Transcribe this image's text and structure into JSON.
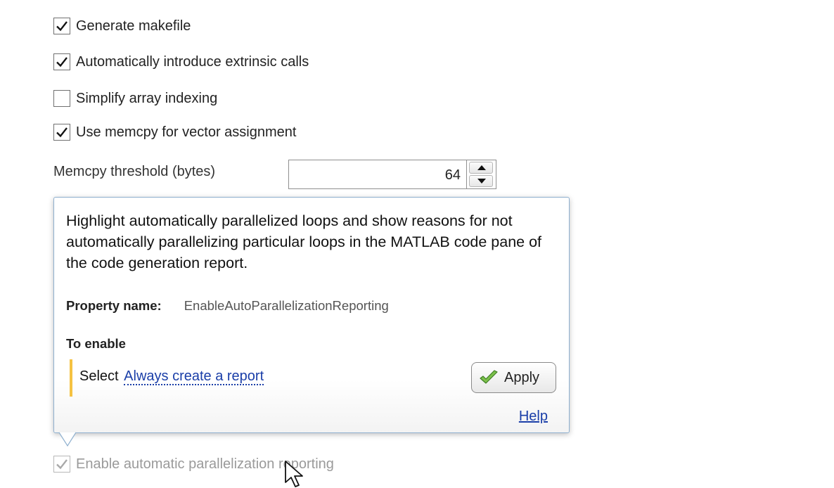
{
  "options": [
    {
      "label": "Generate makefile",
      "checked": true
    },
    {
      "label": "Automatically introduce extrinsic calls",
      "checked": true
    },
    {
      "label": "Simplify array indexing",
      "checked": false
    },
    {
      "label": "Use memcpy for vector assignment",
      "checked": true
    }
  ],
  "memcpy": {
    "label": "Memcpy threshold (bytes)",
    "value": "64"
  },
  "tooltip": {
    "description": "Highlight automatically parallelized loops and show reasons for not automatically parallelizing particular loops in the MATLAB code pane of the code generation report.",
    "property_label": "Property name:",
    "property_value": "EnableAutoParallelizationReporting",
    "to_enable": "To enable",
    "select_prefix": "Select",
    "select_link": "Always create a report",
    "apply_label": "Apply",
    "help_label": "Help",
    "accent_color": "#f5c242"
  },
  "bottom_option": {
    "label": "Enable automatic parallelization reporting",
    "checked": true
  }
}
